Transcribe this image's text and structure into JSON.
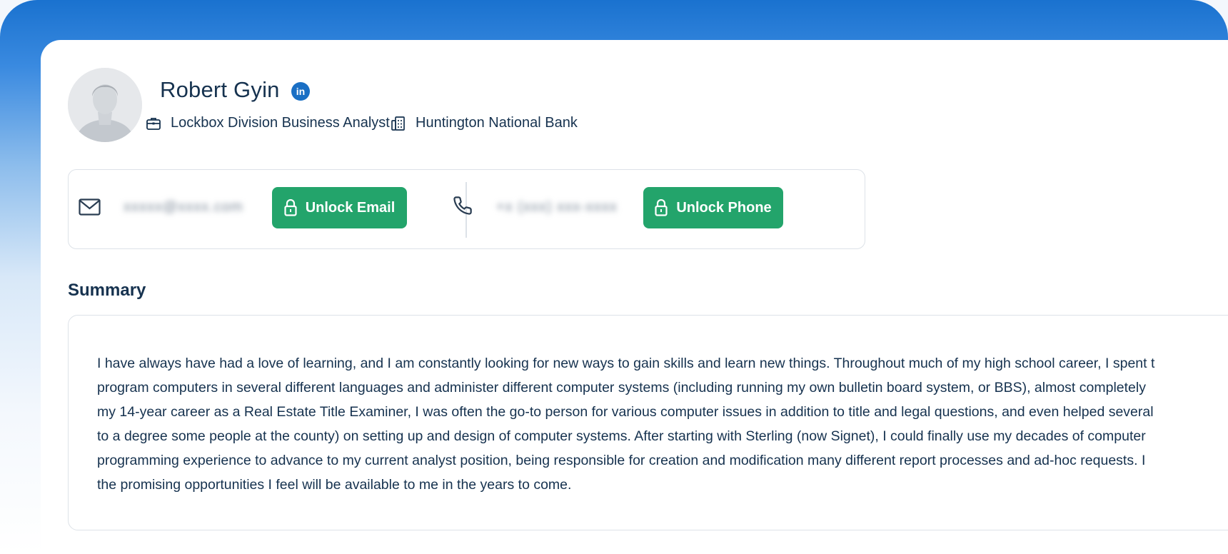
{
  "profile": {
    "name": "Robert Gyin",
    "linkedin_label": "in",
    "job_title": "Lockbox Division Business Analyst",
    "company": "Huntington National Bank"
  },
  "contact": {
    "email_masked": "xxxxx@xxxx.com",
    "email_button": "Unlock Email",
    "phone_masked": "+x (xxx) xxx-xxxx",
    "phone_button": "Unlock Phone"
  },
  "summary": {
    "title": "Summary",
    "lines": [
      "I have always have had a love of learning, and I am constantly looking for new ways to gain skills and learn new things. Throughout much of my high school career, I spent t",
      "program computers in several different languages and administer different computer systems (including running my own bulletin board system, or BBS), almost completely",
      "my 14-year career as a Real Estate Title Examiner, I was often the go-to person for various computer issues in addition to title and legal questions, and even helped several",
      "to a degree some people at the county) on setting up and design of computer systems. After starting with Sterling (now Signet), I could finally use my decades of computer",
      "programming experience to advance to my current analyst position, being responsible for creation and modification many different report processes and ad-hoc requests. I",
      "the promising opportunities I feel will be available to me in the years to come."
    ]
  },
  "colors": {
    "accent_green": "#23a46b",
    "linkedin_blue": "#1a6fc4",
    "text_dark": "#16324f"
  }
}
